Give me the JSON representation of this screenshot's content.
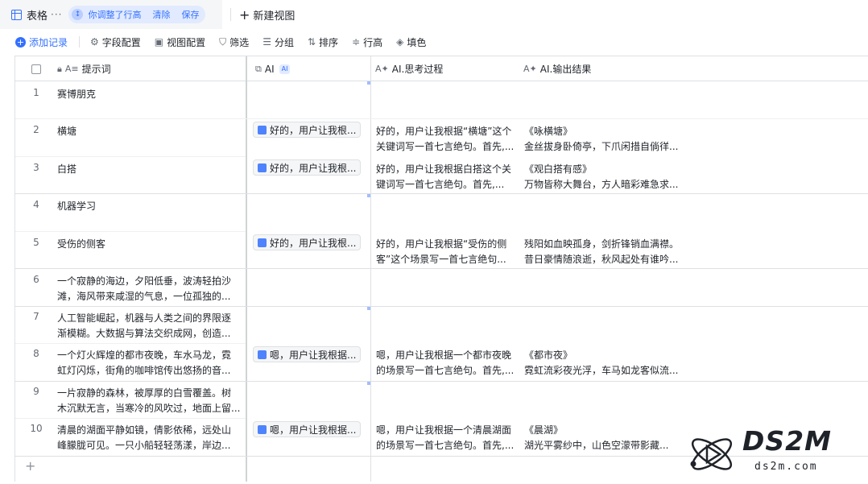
{
  "topbar": {
    "view_name": "表格",
    "view_more": "···",
    "chip_text": "你调整了行高",
    "chip_clear": "清除",
    "chip_save": "保存",
    "new_view": "新建视图"
  },
  "toolbar": {
    "add_record": "添加记录",
    "field_config": "字段配置",
    "view_config": "视图配置",
    "filter": "筛选",
    "group": "分组",
    "sort": "排序",
    "row_height": "行高",
    "fill_color": "填色"
  },
  "columns": {
    "prompt": "提示词",
    "ai": "AI",
    "ai_badge": "AI",
    "think": "AI.思考过程",
    "output": "AI.输出结果"
  },
  "rows": [
    {
      "num": "1",
      "prompt": [
        "赛博朋克"
      ],
      "ai": "",
      "think": [
        "",
        ""
      ],
      "output": [
        "",
        ""
      ]
    },
    {
      "num": "2",
      "prompt": [
        "横塘"
      ],
      "ai": "好的，用户让我根...",
      "think": [
        "好的，用户让我根据“横塘”这个",
        "关键词写一首七言绝句。首先,..."
      ],
      "output": [
        "《咏横塘》",
        "金丝拔身卧倚亭，下爪闲措自倘徉..."
      ]
    },
    {
      "num": "3",
      "prompt": [
        "白搭"
      ],
      "ai": "好的，用户让我根...",
      "think": [
        "好的，用户让我根据白搭这个关",
        "键词写一首七言绝句。首先,..."
      ],
      "output": [
        "《观白搭有感》",
        "万物皆称大舞台，方人暗彩难急求..."
      ]
    },
    {
      "num": "4",
      "prompt": [
        "机器学习"
      ],
      "ai": "",
      "think": [
        "",
        ""
      ],
      "output": [
        "",
        ""
      ]
    },
    {
      "num": "5",
      "prompt": [
        "受伤的侧客"
      ],
      "ai": "好的，用户让我根...",
      "think": [
        "好的，用户让我根据“受伤的侧",
        "客”这个场景写一首七言绝句..."
      ],
      "output": [
        "残阳如血映孤身，剑折锋销血满襟。",
        "昔日豪情随浪逝，秋风起处有谁吟..."
      ]
    },
    {
      "num": "6",
      "prompt": [
        "一个寂静的海边，夕阳低垂，波涛轻拍沙",
        "滩，海风带来咸湿的气息，一位孤独的..."
      ],
      "ai": "",
      "think": [
        "",
        ""
      ],
      "output": [
        "",
        ""
      ]
    },
    {
      "num": "7",
      "prompt": [
        "人工智能崛起，机器与人类之间的界限逐",
        "渐模糊。大数据与算法交织成网，创造..."
      ],
      "ai": "",
      "think": [
        "",
        ""
      ],
      "output": [
        "",
        ""
      ]
    },
    {
      "num": "8",
      "prompt": [
        "一个灯火辉煌的都市夜晚，车水马龙，霓",
        "虹灯闪烁，街角的咖啡馆传出悠扬的音..."
      ],
      "ai": "嗯，用户让我根据...",
      "think": [
        "嗯，用户让我根据一个都市夜晚",
        "的场景写一首七言绝句。首先,..."
      ],
      "output": [
        "《都市夜》",
        "霓虹流彩夜光浮，车马如龙客似流..."
      ]
    },
    {
      "num": "9",
      "prompt": [
        "一片寂静的森林，被厚厚的白雪覆盖。树",
        "木沉默无言，当寒冷的风吹过，地面上留..."
      ],
      "ai": "",
      "think": [
        "",
        ""
      ],
      "output": [
        "",
        ""
      ]
    },
    {
      "num": "10",
      "prompt": [
        "清晨的湖面平静如镜，倩影依稀，远处山",
        "峰朦胧可见。一只小船轻轻荡漾，岸边..."
      ],
      "ai": "嗯，用户让我根据...",
      "think": [
        "嗯，用户让我根据一个清晨湖面",
        "的场景写一首七言绝句。首先,..."
      ],
      "output": [
        "《晨湖》",
        "湖光平雾纱中，山色空濛带影藏..."
      ]
    }
  ],
  "watermark": {
    "name": "DS2M",
    "url": "ds2m.com"
  }
}
